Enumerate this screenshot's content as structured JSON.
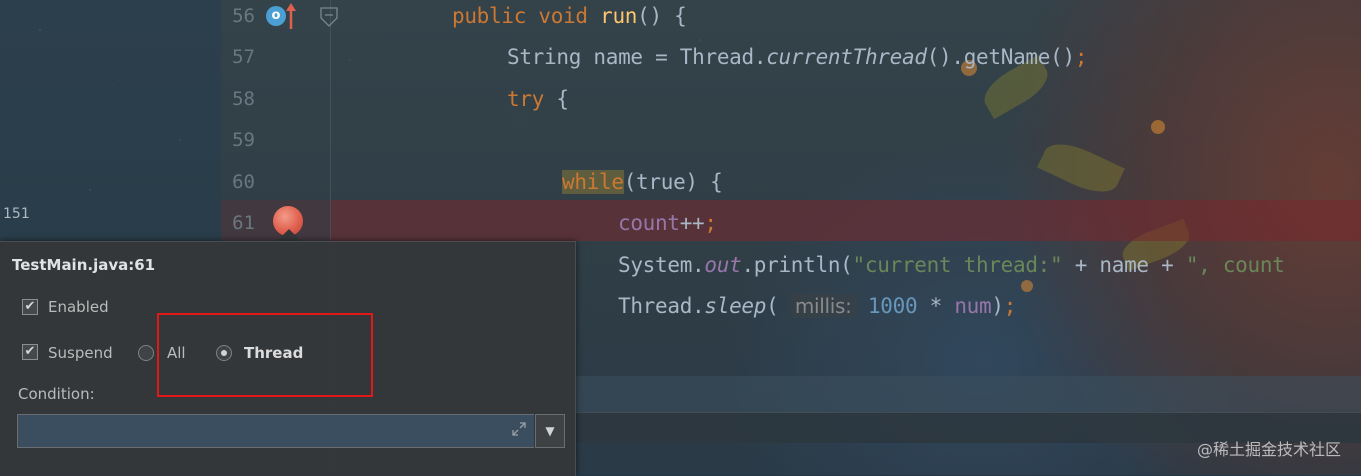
{
  "editor": {
    "line_numbers": [
      "56",
      "57",
      "58",
      "59",
      "60",
      "61"
    ],
    "code": {
      "l56_kw": "public void ",
      "l56_fn": "run",
      "l56_rest": "() {",
      "l57_a": "String name = Thread.",
      "l57_it": "currentThread",
      "l57_b": "().getName()",
      "l57_semi": ";",
      "l58_kw": "try",
      "l58_rest": " {",
      "l60_kw": "while",
      "l60_rest": "(true) {",
      "l61_var": "count",
      "l61_op": "++",
      "l61_semi": ";",
      "l62_a": "System.",
      "l62_field": "out",
      "l62_b": ".println(",
      "l62_str": "\"current thread:\"",
      "l62_c": " + name + ",
      "l62_str2": "\", count",
      "l63_a": "Thread.",
      "l63_it": "sleep",
      "l63_b": "( ",
      "l63_hint": "millis:",
      "l63_num": " 1000",
      "l63_c": " * ",
      "l63_var": "num",
      "l63_d": ")",
      "l63_semi": ";"
    },
    "override_icon_text": "o"
  },
  "side_panel": {
    "number": "151"
  },
  "breakpoint_popup": {
    "title": "TestMain.java:61",
    "enabled_label": "Enabled",
    "enabled_checked": true,
    "suspend_label": "Suspend",
    "suspend_checked": true,
    "suspend_options": [
      "All",
      "Thread"
    ],
    "suspend_selected": "Thread",
    "condition_label": "Condition:",
    "condition_value": ""
  },
  "watermark": "@稀土掘金技术社区",
  "colors": {
    "annotation_box": "#e01818",
    "breakpoint": "#e0604e",
    "keyword": "#cc7832"
  }
}
